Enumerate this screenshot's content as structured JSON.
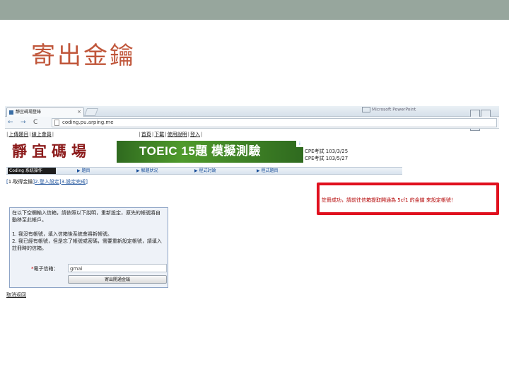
{
  "slide": {
    "title": "寄出金鑰"
  },
  "browser": {
    "tab_title": "靜宜碼場登錄",
    "tab_close": "×",
    "window_title": "Microsoft PowerPoint",
    "nav": {
      "back": "←",
      "forward": "→",
      "reload": "C"
    },
    "url": "coding.pu.arping.me"
  },
  "site": {
    "top_links": {
      "left": [
        "上傳題目",
        "線上會員"
      ],
      "right": [
        "首頁",
        "下載",
        "使用說明",
        "登入"
      ]
    },
    "logo": "靜宜碼場",
    "banner": {
      "text": "TOEIC 15題 模擬測驗",
      "ad_icon": "i"
    },
    "cpe": [
      "CPE考試 103/3/25",
      "CPE考試 103/5/27"
    ],
    "menu": [
      "Coding 系統操作",
      "▶ 題目",
      "▶ 解題狀況",
      "▶ 程式討論",
      "▶ 程式題目"
    ],
    "subtabs": [
      "1.取得金鑰",
      "2.登入設定",
      "3.設定完成"
    ],
    "success_message": "註冊成功，請前往信箱提取開通為 5cf1 的金鑰 來設定帳號！",
    "form": {
      "intro": "在以下空欄輸入信箱，請依照以下說明，重新設定，原先的帳號將自動移至此帳戶。",
      "notes": [
        "1. 我沒有帳號，填入信箱後系統會將新帳號。",
        "2. 我已經有帳號，但是忘了帳號或密碼，需要重新設定帳號，請填入註冊時的信箱。"
      ],
      "email_label": "電子信箱",
      "email_value": "          gmai",
      "send_button": "寄出開通金鑰"
    },
    "back_link": "取消返回"
  }
}
